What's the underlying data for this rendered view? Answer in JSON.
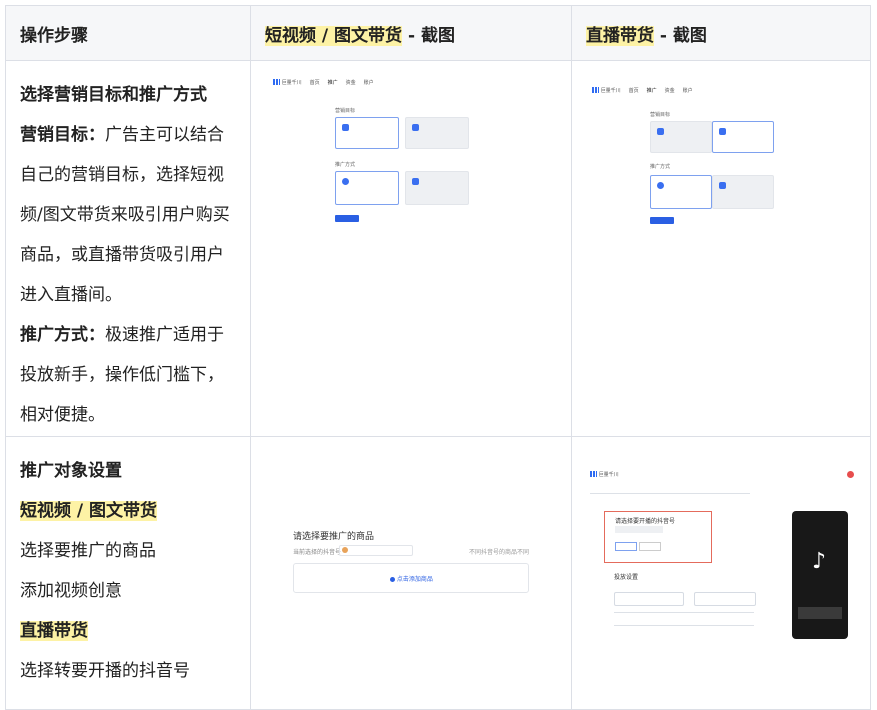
{
  "header": {
    "col1": "操作步骤",
    "col2_hl": "短视频 / 图文带货",
    "col2_rest": " - 截图",
    "col3_hl": "直播带货",
    "col3_rest": " - 截图"
  },
  "row1": {
    "title": "选择营销目标和推广方式",
    "para1_bold": "营销目标：",
    "para1_text": "广告主可以结合自己的营销目标，选择短视频/图文带货来吸引用户购买商品，或直播带货吸引用户进入直播间。",
    "para2_bold": "推广方式：",
    "para2_text": "极速推广适用于投放新手，操作低门槛下，相对便捷。",
    "shot_a": {
      "brand": "巨量千川",
      "nav": [
        "首页",
        "推广",
        "资金",
        "账户"
      ],
      "section1": "营销目标",
      "section2": "推广方式"
    },
    "shot_b": {
      "brand": "巨量千川",
      "nav": [
        "首页",
        "推广",
        "资金",
        "账户"
      ],
      "section1": "营销目标",
      "section2": "推广方式"
    }
  },
  "row2": {
    "title": "推广对象设置",
    "sub1_hl": "短视频 / 图文带货",
    "sub1_line1": "选择要推广的商品",
    "sub1_line2": "添加视频创意",
    "sub2_hl": "直播带货",
    "sub2_line1": "选择转要开播的抖音号",
    "shot_c": {
      "heading": "请选择要推广的商品",
      "field_label": "当前选择的抖音号",
      "right_text": "不同抖音号的商品不同",
      "add_btn": "点击添加商品"
    },
    "shot_d": {
      "brand": "巨量千川",
      "boxtitle": "请选择要开播的抖音号",
      "section": "投放设置"
    }
  },
  "colors": {
    "highlight": "#fdf2a5",
    "border": "#dcdfe6",
    "accent": "#2a5fe3"
  }
}
